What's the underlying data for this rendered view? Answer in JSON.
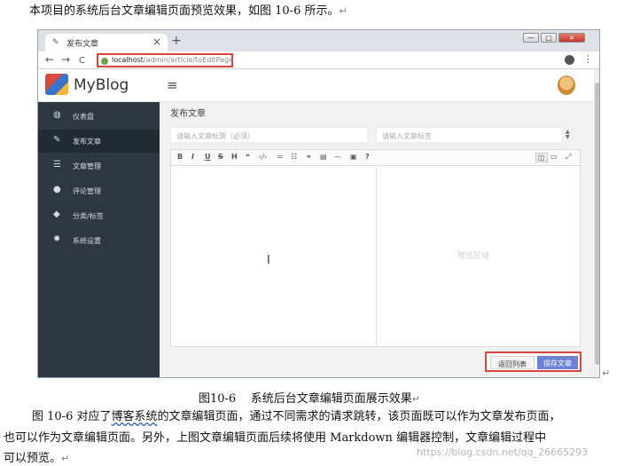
{
  "intro": "本项目的系统后台文章编辑页面预览效果，如图 10-6 所示。",
  "para_mark": "↵",
  "browser": {
    "tab_title": "发布文章",
    "tab_close": "×",
    "new_tab": "+",
    "back": "←",
    "forward": "→",
    "reload": "C",
    "url_host": "localhost",
    "url_path": "/admin/article/toEditPage",
    "kebab": "⋮",
    "win_min": "—",
    "win_max": "□",
    "win_close": "×"
  },
  "app": {
    "brand": "MyBlog",
    "hamburger": "≡",
    "menu": [
      {
        "label": "仪表盘",
        "icon": "◍"
      },
      {
        "label": "发布文章",
        "icon": "✎"
      },
      {
        "label": "文章管理",
        "icon": "☰"
      },
      {
        "label": "评论管理",
        "icon": "●"
      },
      {
        "label": "分类/标签",
        "icon": "◆"
      },
      {
        "label": "系统设置",
        "icon": "✹"
      }
    ],
    "page_title": "发布文章",
    "title_placeholder": "请输入文章标题（必须）",
    "tags_placeholder": "请输入文章标签",
    "spin": [
      "▲",
      "▼"
    ],
    "toolbar": [
      "B",
      "I",
      "U",
      "S",
      "H",
      "❝",
      "‹/›",
      "≔",
      "☷",
      "⚭",
      "▤",
      "—",
      "▣",
      "?"
    ],
    "view_buttons": [
      "◫",
      "▭",
      "⤢"
    ],
    "preview_hint": "预览区域",
    "cursor": "I",
    "back_button": "返回列表",
    "save_button": "保存文章"
  },
  "caption": "图10-6    系统后台文章编辑页面展示效果",
  "body": {
    "line1_a": "图 10-6 对应了",
    "line1_b": "博客系统",
    "line1_c": "的文章编辑页面，通过不同需求的请求跳转，该页面既可以作为文章发布页面，",
    "line2": "也可以作为文章编辑页面。另外，上图文章编辑页面后续将使用 Markdown 编辑器控制，文章编辑过程中",
    "line3": "可以预览。"
  },
  "watermark": "https://blog.csdn.net/qq_26665293"
}
